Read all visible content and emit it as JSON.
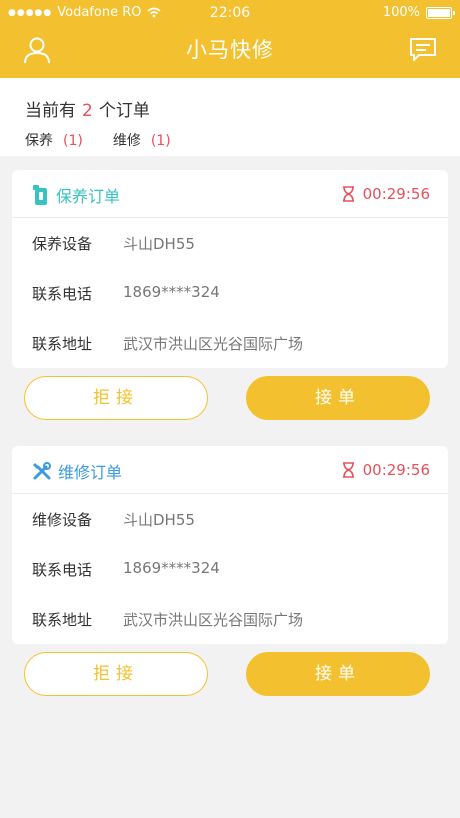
{
  "status_bar": {
    "carrier": "Vodafone RO",
    "time": "22:06",
    "battery": "100%"
  },
  "nav": {
    "title": "小马快修",
    "left_icon": "user-icon",
    "right_icon": "message-icon"
  },
  "summary": {
    "prefix": "当前有",
    "count": "2",
    "suffix": "个订单",
    "tabs": [
      {
        "label": "保养",
        "count": "(1)"
      },
      {
        "label": "维修",
        "count": "(1)"
      }
    ]
  },
  "orders": [
    {
      "title": "保养订单",
      "icon": "maintenance-icon",
      "color": "#37c3c2",
      "timer": "00:29:56",
      "rows": [
        {
          "label": "保养设备",
          "value": "斗山DH55"
        },
        {
          "label": "联系电话",
          "value": "1869****324"
        },
        {
          "label": "联系地址",
          "value": "武汉市洪山区光谷国际广场"
        }
      ],
      "reject_label": "拒接",
      "accept_label": "接单"
    },
    {
      "title": "维修订单",
      "icon": "tools-icon",
      "color": "#3a9be0",
      "timer": "00:29:56",
      "rows": [
        {
          "label": "维修设备",
          "value": "斗山DH55"
        },
        {
          "label": "联系电话",
          "value": "1869****324"
        },
        {
          "label": "联系地址",
          "value": "武汉市洪山区光谷国际广场"
        }
      ],
      "reject_label": "拒接",
      "accept_label": "接单"
    }
  ],
  "colors": {
    "brand": "#f3c12f",
    "alert": "#e8505b"
  }
}
